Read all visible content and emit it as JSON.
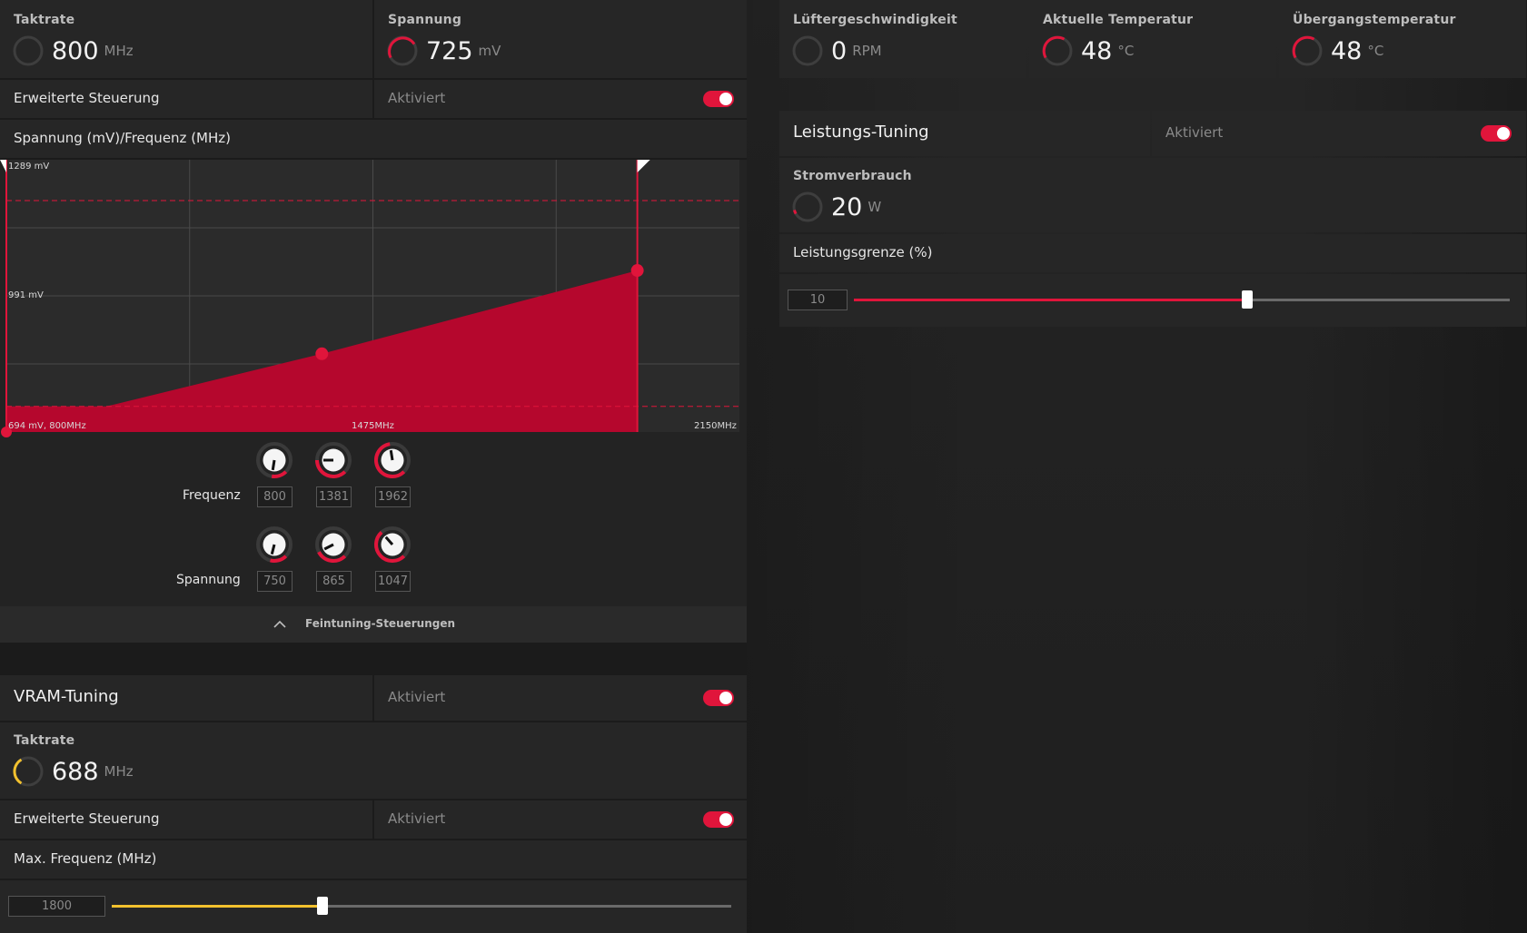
{
  "gpu": {
    "clock": {
      "label": "Taktrate",
      "value": "800",
      "unit": "MHz"
    },
    "voltage": {
      "label": "Spannung",
      "value": "725",
      "unit": "mV"
    },
    "advanced": {
      "label": "Erweiterte Steuerung",
      "status": "Aktiviert",
      "enabled": true
    },
    "curve_title": "Spannung (mV)/Frequenz (MHz)",
    "freq_label": "Frequenz",
    "volt_label": "Spannung",
    "freq_values": [
      "800",
      "1381",
      "1962"
    ],
    "volt_values": [
      "750",
      "865",
      "1047"
    ],
    "finetune_label": "Feintuning-Steuerungen"
  },
  "chart_data": {
    "type": "area",
    "x": [
      800,
      1381,
      1962
    ],
    "y": [
      750,
      865,
      1047
    ],
    "xlim": [
      800,
      2150
    ],
    "ylim": [
      694,
      1289
    ],
    "labels": {
      "y_top": "1289 mV",
      "y_mid": "991 mV",
      "origin": "694 mV, 800MHz",
      "x_mid": "1475MHz",
      "x_max": "2150MHz"
    },
    "fill_color": "#b5072d",
    "grid": true
  },
  "sensors": {
    "fan": {
      "label": "Lüftergeschwindigkeit",
      "value": "0",
      "unit": "RPM"
    },
    "temp": {
      "label": "Aktuelle Temperatur",
      "value": "48",
      "unit": "°C"
    },
    "junction": {
      "label": "Übergangstemperatur",
      "value": "48",
      "unit": "°C"
    }
  },
  "power": {
    "title": "Leistungs-Tuning",
    "status": "Aktiviert",
    "consumption": {
      "label": "Stromverbrauch",
      "value": "20",
      "unit": "W"
    },
    "limit": {
      "label": "Leistungsgrenze (%)",
      "value": "10",
      "fraction": 0.6
    }
  },
  "vram": {
    "title": "VRAM-Tuning",
    "status": "Aktiviert",
    "clock": {
      "label": "Taktrate",
      "value": "688",
      "unit": "MHz"
    },
    "advanced": {
      "label": "Erweiterte Steuerung",
      "status": "Aktiviert"
    },
    "maxfreq": {
      "label": "Max. Frequenz (MHz)",
      "value": "1800",
      "fraction": 0.34
    }
  },
  "colors": {
    "accent": "#e0153b",
    "vram_accent": "#f2c12e",
    "chart_fill": "#b5072d"
  }
}
